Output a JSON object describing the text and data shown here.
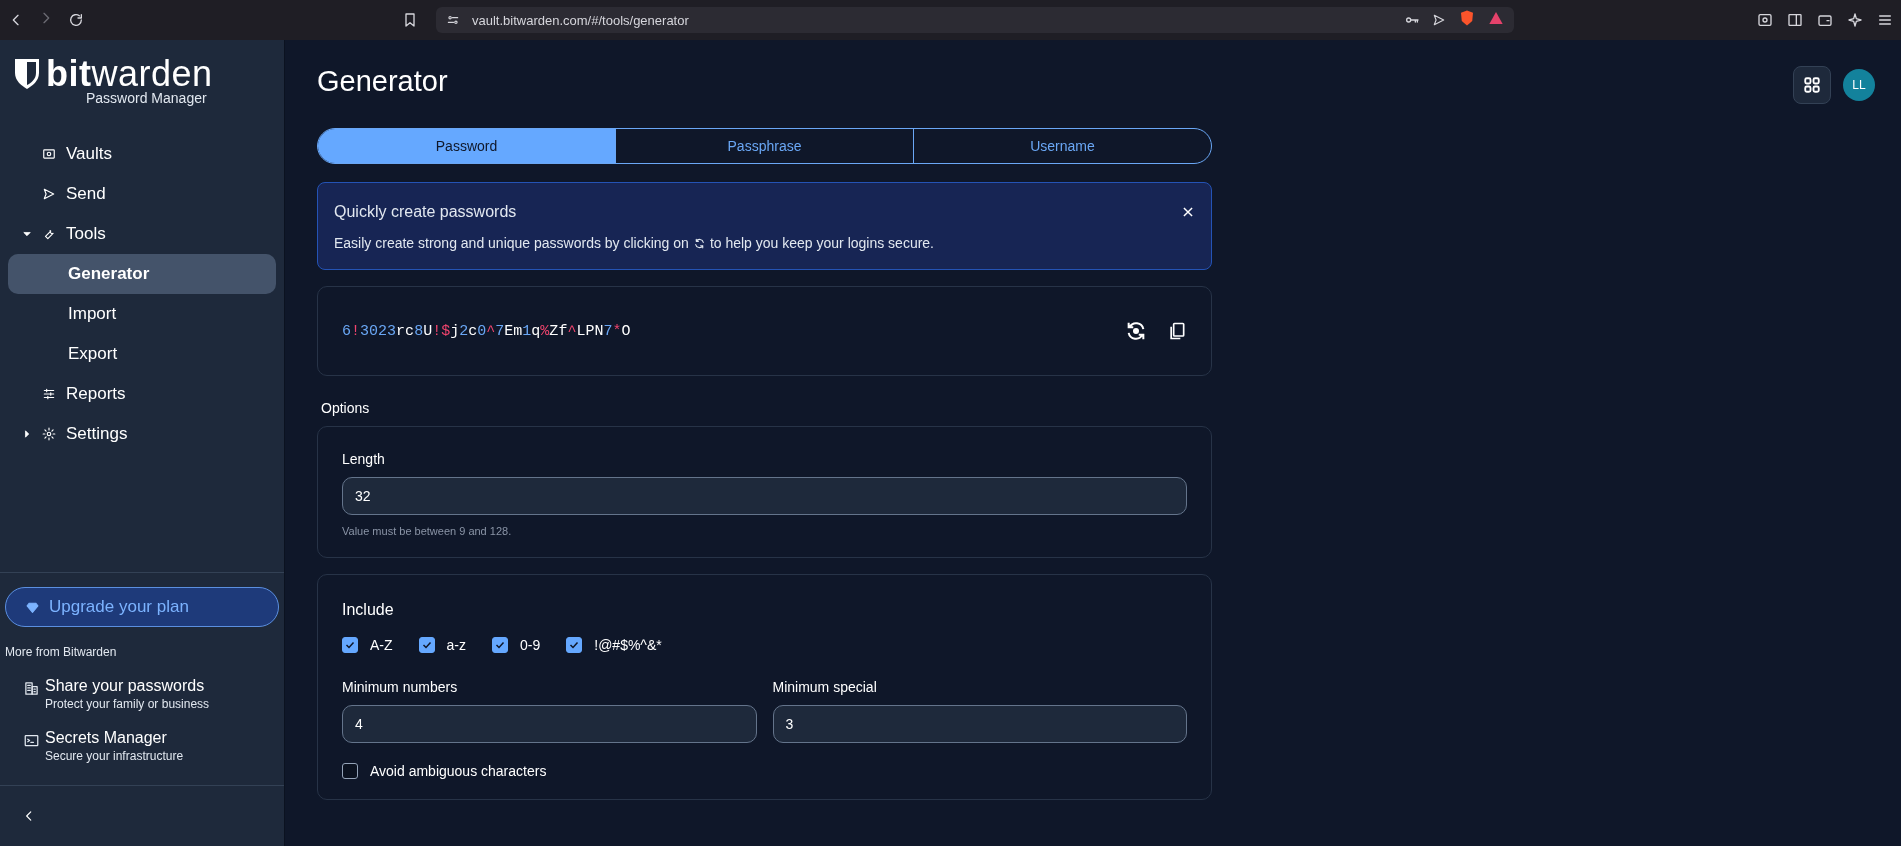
{
  "browser": {
    "url": "vault.bitwarden.com/#/tools/generator"
  },
  "sidebar": {
    "logo": "**bit**warden",
    "subtitle": "Password Manager",
    "items": [
      {
        "label": "Vaults",
        "selected": false
      },
      {
        "label": "Send",
        "selected": false
      },
      {
        "label": "Tools",
        "expanded": true,
        "selected": false,
        "children": [
          {
            "label": "Generator",
            "selected": true
          },
          {
            "label": "Import",
            "selected": false
          },
          {
            "label": "Export",
            "selected": false
          }
        ]
      },
      {
        "label": "Reports",
        "selected": false
      },
      {
        "label": "Settings",
        "expanded": false,
        "selected": false
      }
    ],
    "upgrade": "Upgrade your plan",
    "more_heading": "More from Bitwarden",
    "products": [
      {
        "title": "Share your passwords",
        "subtitle": "Protect your family or business"
      },
      {
        "title": "Secrets Manager",
        "subtitle": "Secure your infrastructure"
      }
    ]
  },
  "page": {
    "title": "Generator",
    "avatar": "LL"
  },
  "tabs": [
    {
      "label": "Password",
      "selected": true
    },
    {
      "label": "Passphrase",
      "selected": false
    },
    {
      "label": "Username",
      "selected": false
    }
  ],
  "callout": {
    "title": "Quickly create passwords",
    "text_before": "Easily create strong and unique passwords by clicking on",
    "text_after": "to help you keep your logins secure."
  },
  "password": "6!3023rc8U!$j2c0^7Em1q%Zf^LPN7*O",
  "options": {
    "heading": "Options",
    "length_label": "Length",
    "length": "32",
    "length_hint": "Value must be between 9 and 128.",
    "include_heading": "Include",
    "include": [
      {
        "label": "A-Z",
        "checked": true
      },
      {
        "label": "a-z",
        "checked": true
      },
      {
        "label": "0-9",
        "checked": true
      },
      {
        "label": "!@#$%^&*",
        "checked": true
      }
    ],
    "min_numbers_label": "Minimum numbers",
    "min_numbers": "4",
    "min_special_label": "Minimum special",
    "min_special": "3",
    "avoid_ambiguous": {
      "label": "Avoid ambiguous characters",
      "checked": false
    }
  }
}
